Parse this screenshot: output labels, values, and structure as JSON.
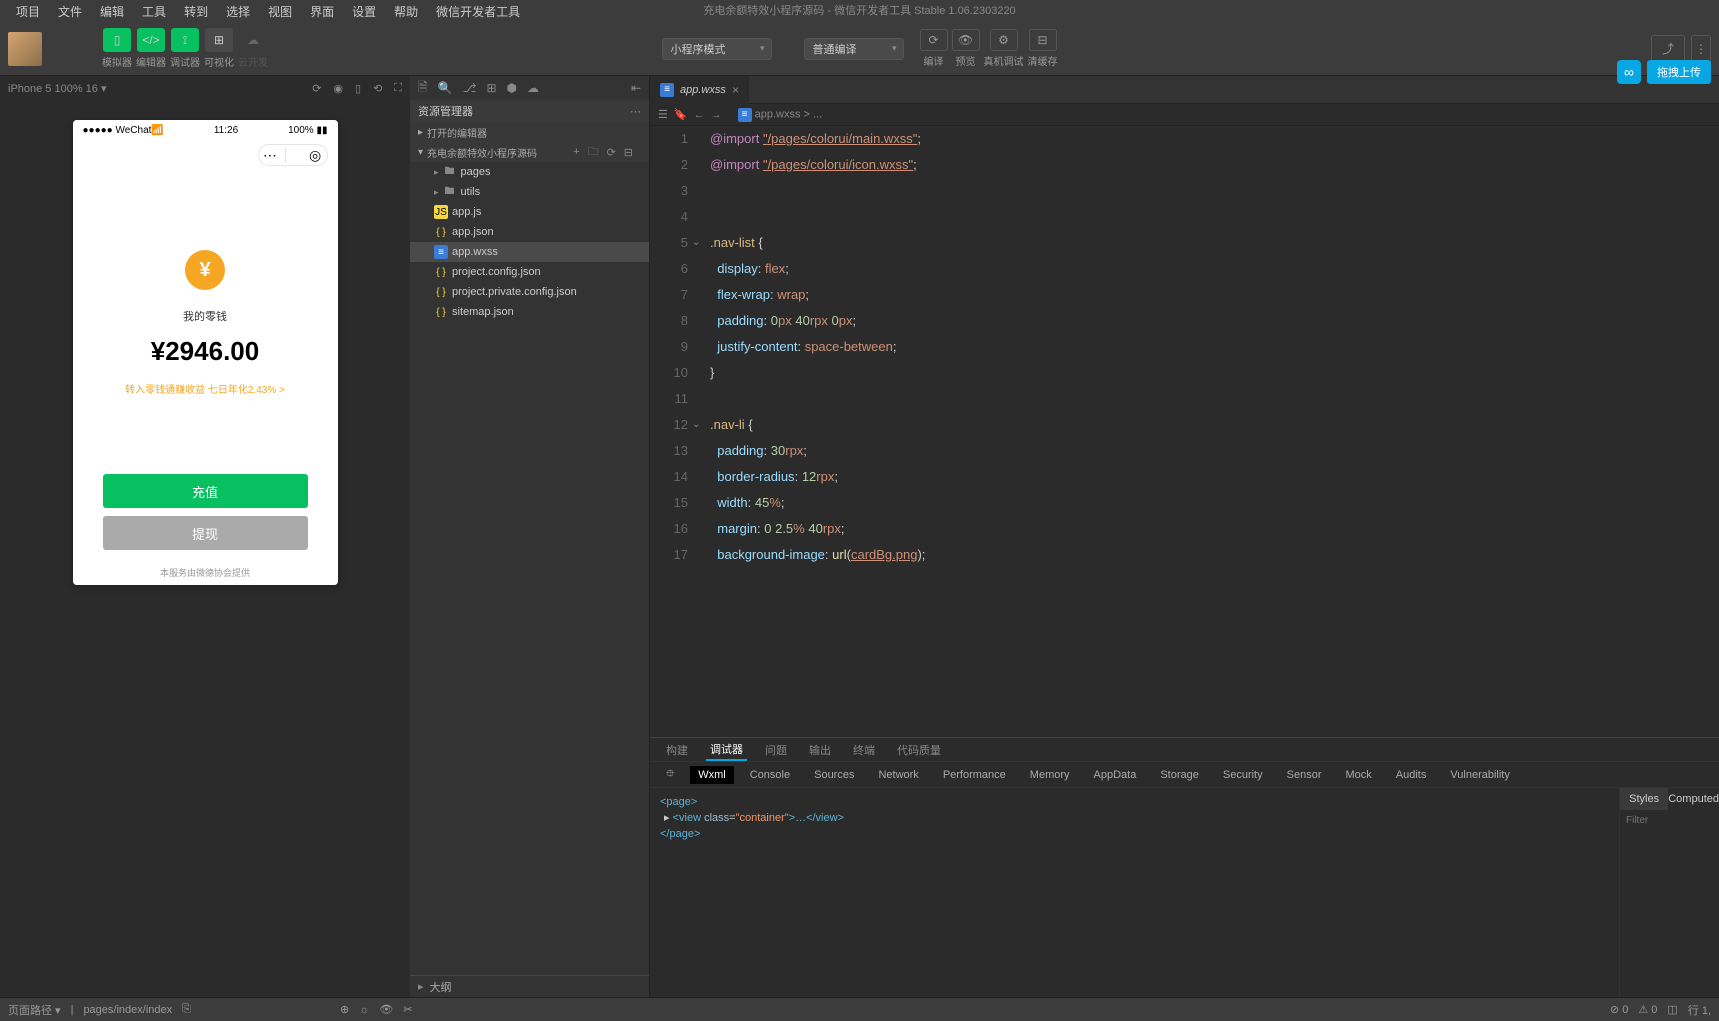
{
  "menubar": [
    "项目",
    "文件",
    "编辑",
    "工具",
    "转到",
    "选择",
    "视图",
    "界面",
    "设置",
    "帮助",
    "微信开发者工具"
  ],
  "title": "充电余额特效小程序源码 - 微信开发者工具 Stable 1.06.2303220",
  "toolbar": {
    "labels": [
      "模拟器",
      "编辑器",
      "调试器",
      "可视化",
      "云开发"
    ],
    "mode": "小程序模式",
    "compile": "普通编译",
    "actions": [
      "编译",
      "预览",
      "真机调试",
      "清缓存"
    ],
    "upload": "拖拽上传"
  },
  "sim": {
    "device": "iPhone 5 100% 16",
    "status_l": "●●●●● WeChat",
    "status_time": "11:26",
    "status_r": "100%",
    "wallet_label": "我的零钱",
    "wallet_amount": "¥2946.00",
    "wallet_tip": "转入零钱通赚收益 七日年化2.43% >",
    "btn_recharge": "充值",
    "btn_withdraw": "提现",
    "footer": "本服务由微德协会提供"
  },
  "explorer": {
    "title": "资源管理器",
    "sections": [
      "打开的编辑器",
      "充电余额特效小程序源码"
    ],
    "files": [
      {
        "name": "pages",
        "type": "folder",
        "indent": 1
      },
      {
        "name": "utils",
        "type": "folder",
        "indent": 1
      },
      {
        "name": "app.js",
        "type": "js",
        "indent": 1
      },
      {
        "name": "app.json",
        "type": "json",
        "indent": 1
      },
      {
        "name": "app.wxss",
        "type": "wxss",
        "indent": 1,
        "sel": true
      },
      {
        "name": "project.config.json",
        "type": "json",
        "indent": 1
      },
      {
        "name": "project.private.config.json",
        "type": "json",
        "indent": 1
      },
      {
        "name": "sitemap.json",
        "type": "json",
        "indent": 1
      }
    ],
    "outline": "大纲"
  },
  "editor": {
    "tab": "app.wxss",
    "breadcrumb": "app.wxss > ...",
    "lines": [
      {
        "n": 1,
        "t": "import",
        "s": "\"/pages/colorui/main.wxss\""
      },
      {
        "n": 2,
        "t": "import",
        "s": "\"/pages/colorui/icon.wxss\""
      },
      {
        "n": 3,
        "t": "blank"
      },
      {
        "n": 4,
        "t": "blank"
      },
      {
        "n": 5,
        "t": "sel",
        "s": ".nav-list {"
      },
      {
        "n": 6,
        "t": "decl",
        "p": "display",
        "v": "flex"
      },
      {
        "n": 7,
        "t": "decl",
        "p": "flex-wrap",
        "v": "wrap"
      },
      {
        "n": 8,
        "t": "decl3",
        "p": "padding",
        "v1": "0",
        "u1": "px",
        "v2": "40",
        "u2": "rpx",
        "v3": "0",
        "u3": "px"
      },
      {
        "n": 9,
        "t": "decl",
        "p": "justify-content",
        "v": "space-between"
      },
      {
        "n": 10,
        "t": "close"
      },
      {
        "n": 11,
        "t": "blank"
      },
      {
        "n": 12,
        "t": "sel",
        "s": ".nav-li {"
      },
      {
        "n": 13,
        "t": "decl1",
        "p": "padding",
        "v": "30",
        "u": "rpx"
      },
      {
        "n": 14,
        "t": "decl1",
        "p": "border-radius",
        "v": "12",
        "u": "rpx"
      },
      {
        "n": 15,
        "t": "decl1",
        "p": "width",
        "v": "45",
        "u": "%"
      },
      {
        "n": 16,
        "t": "decl3",
        "p": "margin",
        "v1": "0",
        "u1": "",
        "v2": "2.5",
        "u2": "%",
        "v3": "40",
        "u3": "rpx"
      },
      {
        "n": 17,
        "t": "url",
        "p": "background-image",
        "f": "url",
        "a": "cardBg.png"
      }
    ]
  },
  "devtools": {
    "tabs1": [
      "构建",
      "调试器",
      "问题",
      "输出",
      "终端",
      "代码质量"
    ],
    "tabs2": [
      "Wxml",
      "Console",
      "Sources",
      "Network",
      "Performance",
      "Memory",
      "AppData",
      "Storage",
      "Security",
      "Sensor",
      "Mock",
      "Audits",
      "Vulnerability"
    ],
    "side_tabs": [
      "Styles",
      "Computed"
    ],
    "filter": "Filter",
    "dom": {
      "l1": "<page>",
      "l2_open": "<view ",
      "l2_attr": "class",
      "l2_val": "\"container\"",
      "l2_mid": ">…</view>",
      "l3": "</page>"
    }
  },
  "statusbar": {
    "path_label": "页面路径",
    "path": "pages/index/index",
    "pos": "行 1,"
  }
}
